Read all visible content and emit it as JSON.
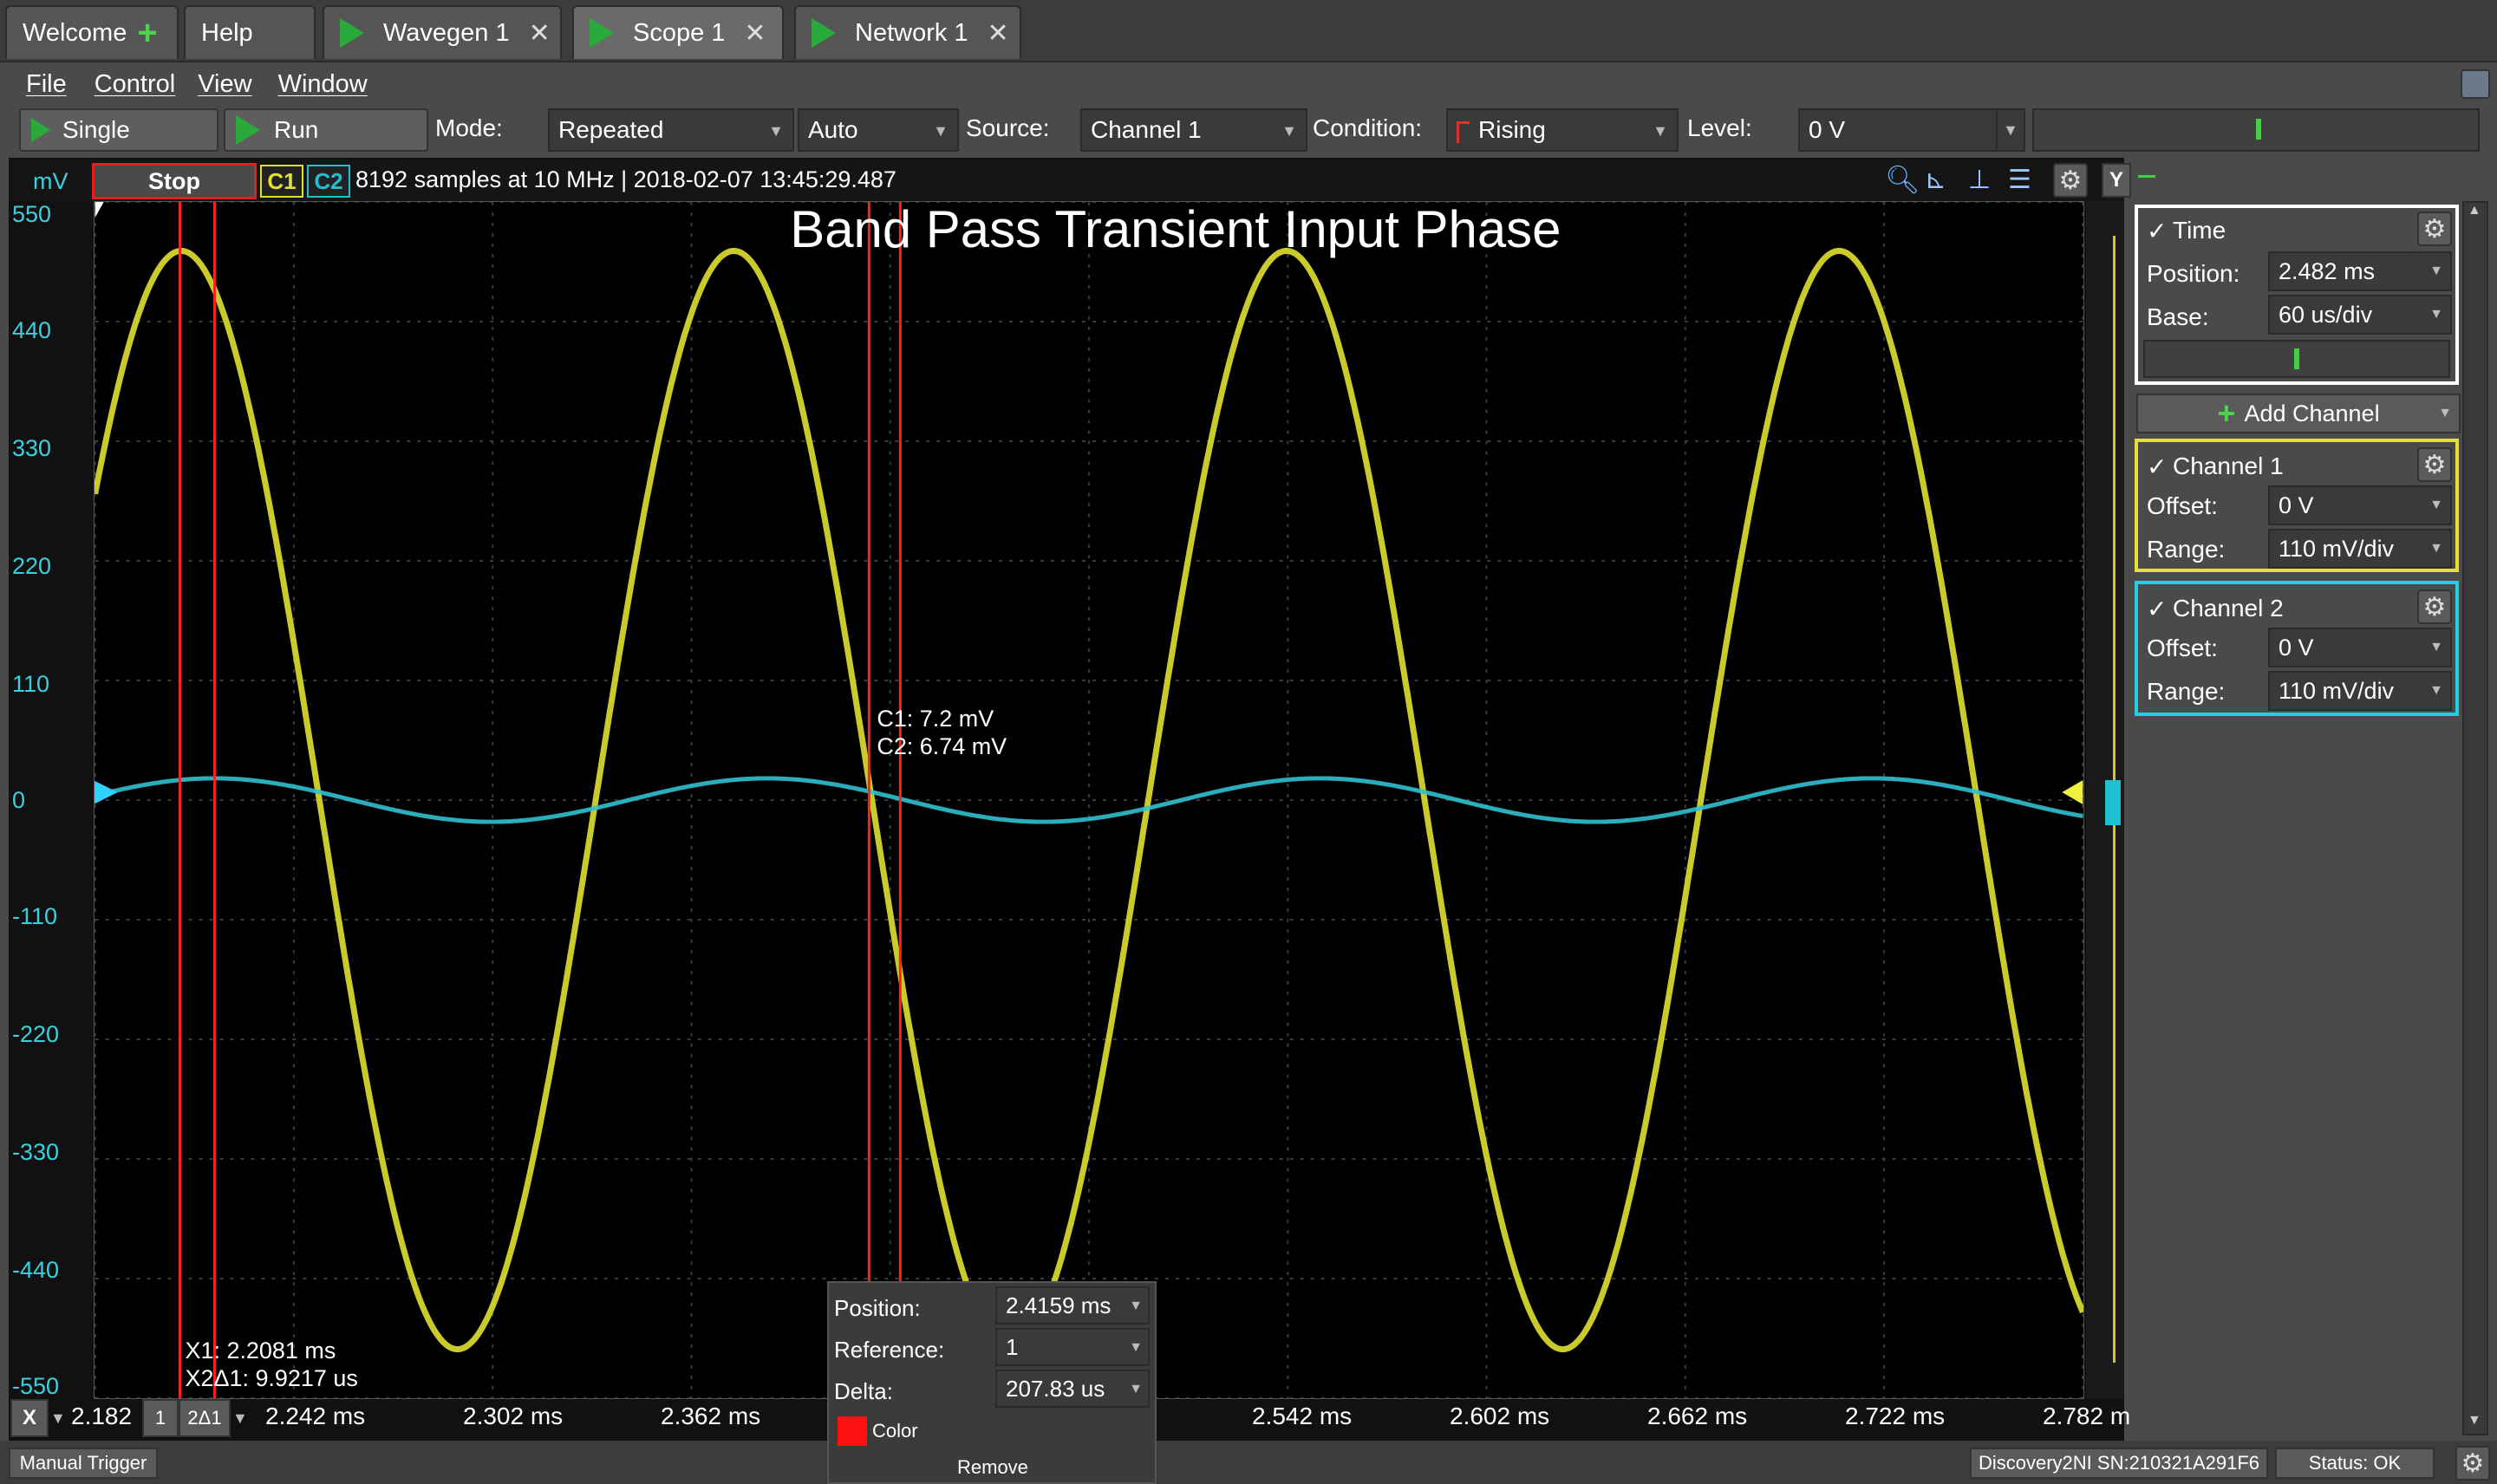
{
  "tabs": [
    {
      "label": "Welcome",
      "icon": "plus-icon"
    },
    {
      "label": "Help"
    },
    {
      "label": "Wavegen 1",
      "icon": "play-icon"
    },
    {
      "label": "Scope 1",
      "icon": "play-icon"
    },
    {
      "label": "Network 1",
      "icon": "play-icon"
    }
  ],
  "menu": [
    "File",
    "Control",
    "View",
    "Window"
  ],
  "toolbar": {
    "single_label": "Single",
    "run_label": "Run",
    "mode_label": "Mode:",
    "mode_value": "Repeated",
    "auto_value": "Auto",
    "source_label": "Source:",
    "source_value": "Channel 1",
    "condition_label": "Condition:",
    "condition_value": "Rising",
    "level_label": "Level:",
    "level_value": "0 V"
  },
  "infobar": {
    "units": "mV",
    "stop_label": "Stop",
    "c1": "C1",
    "c2": "C2",
    "info": "8192 samples at 10 MHz | 2018-02-07 13:45:29.487",
    "y_button": "Y"
  },
  "plot": {
    "title": "Band Pass Transient Input Phase",
    "y_ticks": [
      "550",
      "440",
      "330",
      "220",
      "110",
      "0",
      "-110",
      "-220",
      "-330",
      "-440",
      "-550"
    ],
    "x_ticks": [
      "2.182",
      "2.242 ms",
      "2.302 ms",
      "2.362 ms",
      "2.542 ms",
      "2.602 ms",
      "2.662 ms",
      "2.722 ms",
      "2.782 m"
    ],
    "cursor_readout": {
      "c1": "C1: 7.2 mV",
      "c2": "C2: 6.74 mV"
    },
    "x1_readout": "X1: 2.2081 ms",
    "x2_readout": "X2Δ1: 9.9217 us",
    "x_button": "X",
    "cursor_btn1": "1",
    "cursor_btn2": "2Δ1"
  },
  "chart_data": {
    "type": "line",
    "title": "Band Pass Transient Input Phase",
    "ylabel": "mV",
    "xlim": [
      2.182,
      2.782
    ],
    "ylim": [
      -550,
      550
    ],
    "series": [
      {
        "name": "C1",
        "color": "#e0e030",
        "amplitude": 505,
        "period_ms": 0.1668,
        "peak_x": 2.208
      },
      {
        "name": "C2",
        "color": "#30c0d0",
        "amplitude": 20,
        "period_ms": 0.1668,
        "peak_x": 2.218
      }
    ]
  },
  "time_panel": {
    "title": "Time",
    "position_label": "Position:",
    "position_value": "2.482 ms",
    "base_label": "Base:",
    "base_value": "60 us/div"
  },
  "add_channel_label": "Add Channel",
  "channel1": {
    "title": "Channel 1",
    "offset_label": "Offset:",
    "offset_value": "0 V",
    "range_label": "Range:",
    "range_value": "110 mV/div",
    "color": "#e6e030"
  },
  "channel2": {
    "title": "Channel 2",
    "offset_label": "Offset:",
    "offset_value": "0 V",
    "range_label": "Range:",
    "range_value": "110 mV/div",
    "color": "#20d0e0"
  },
  "popup": {
    "position_label": "Position:",
    "position_value": "2.4159 ms",
    "reference_label": "Reference:",
    "reference_value": "1",
    "delta_label": "Delta:",
    "delta_value": "207.83 us",
    "color_label": "Color",
    "remove_label": "Remove"
  },
  "status": {
    "manual_trigger": "Manual Trigger",
    "device": "Discovery2NI SN:210321A291F6",
    "status_text": "Status: OK"
  }
}
